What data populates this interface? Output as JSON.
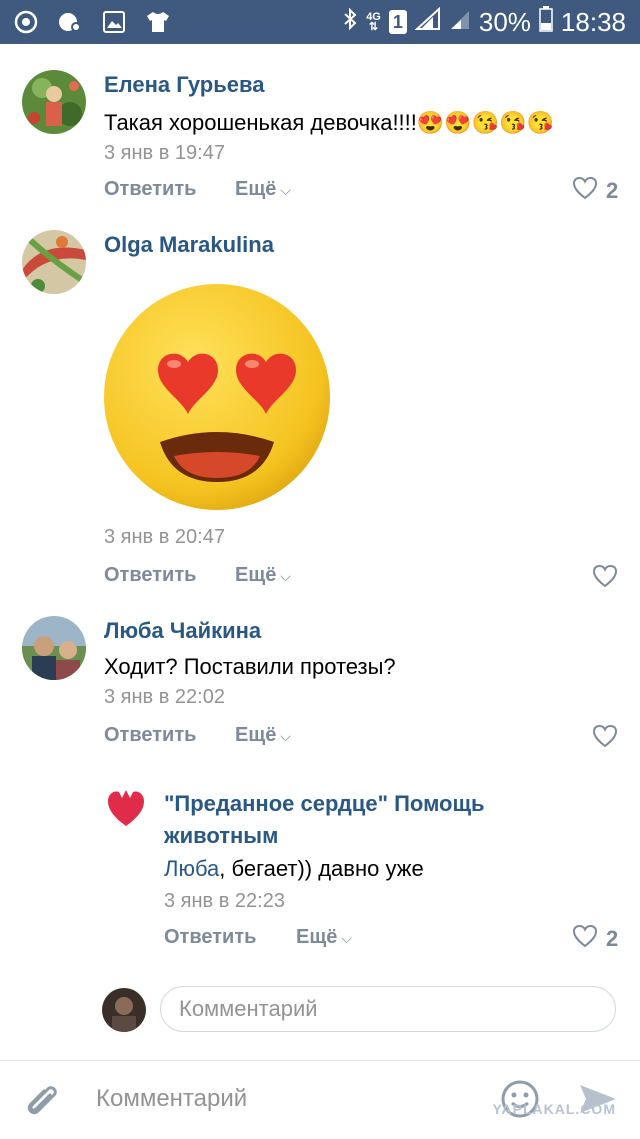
{
  "status_bar": {
    "network": "4G",
    "sim": "1",
    "battery": "30%",
    "time": "18:38"
  },
  "comments": [
    {
      "author": "Елена Гурьева",
      "text": "Такая хорошенькая девочка!!!!",
      "emojis": "😍😍😘😘😘",
      "date": "3 янв в 19:47",
      "reply": "Ответить",
      "more": "Ещё",
      "likes": "2"
    },
    {
      "author": "Olga Marakulina",
      "sticker": "heart-eyes-sticker",
      "date": "3 янв в 20:47",
      "reply": "Ответить",
      "more": "Ещё"
    },
    {
      "author": "Люба Чайкина",
      "text": "Ходит? Поставили протезы?",
      "date": "3 янв в 22:02",
      "reply": "Ответить",
      "more": "Ещё"
    },
    {
      "author_line1": "\"Преданное сердце\" Помощь",
      "author_line2": "животным",
      "mention": "Люба",
      "text": ", бегает)) давно уже",
      "date": "3 янв в 22:23",
      "reply": "Ответить",
      "more": "Ещё",
      "likes": "2"
    }
  ],
  "inline_comment_placeholder": "Комментарий",
  "bottom_comment_placeholder": "Комментарий",
  "watermark": "YAPLAKAL.COM",
  "colors": {
    "status_bar": "#3f5a7e",
    "author": "#2a5885",
    "date": "#939393",
    "action": "#7e8a99"
  }
}
